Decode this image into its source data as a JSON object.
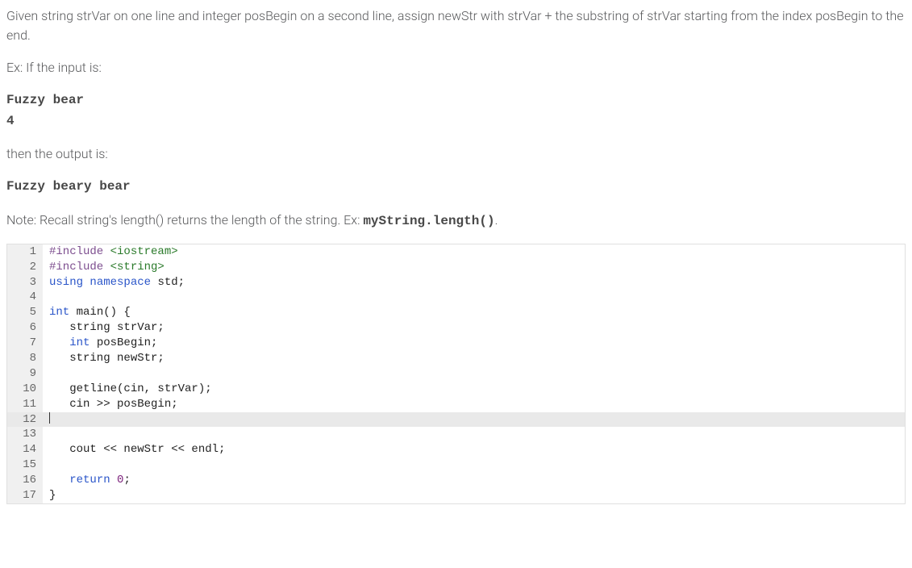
{
  "problem": {
    "p1": "Given string strVar on one line and integer posBegin on a second line, assign newStr with strVar + the substring of strVar starting from the index posBegin to the end.",
    "ex_label": "Ex: If the input is:",
    "input_line1": "Fuzzy bear",
    "input_line2": "4",
    "then_label": "then the output is:",
    "output_line": "Fuzzy beary bear",
    "note_prefix": "Note: Recall string's length() returns the length of the string. Ex: ",
    "note_code": "myString.length()",
    "note_suffix": "."
  },
  "code": {
    "lines": [
      {
        "n": "1",
        "editable": false,
        "tokens": [
          {
            "t": "#include ",
            "c": "pre"
          },
          {
            "t": "<iostream>",
            "c": "str"
          }
        ]
      },
      {
        "n": "2",
        "editable": false,
        "tokens": [
          {
            "t": "#include ",
            "c": "pre"
          },
          {
            "t": "<string>",
            "c": "str"
          }
        ]
      },
      {
        "n": "3",
        "editable": false,
        "tokens": [
          {
            "t": "using ",
            "c": "kw"
          },
          {
            "t": "namespace ",
            "c": "kw"
          },
          {
            "t": "std;",
            "c": ""
          }
        ]
      },
      {
        "n": "4",
        "editable": false,
        "tokens": [
          {
            "t": "",
            "c": ""
          }
        ]
      },
      {
        "n": "5",
        "editable": false,
        "tokens": [
          {
            "t": "int ",
            "c": "kw"
          },
          {
            "t": "main() {",
            "c": ""
          }
        ]
      },
      {
        "n": "6",
        "editable": false,
        "tokens": [
          {
            "t": "   string strVar;",
            "c": ""
          }
        ]
      },
      {
        "n": "7",
        "editable": false,
        "tokens": [
          {
            "t": "   ",
            "c": ""
          },
          {
            "t": "int ",
            "c": "kw"
          },
          {
            "t": "posBegin;",
            "c": ""
          }
        ]
      },
      {
        "n": "8",
        "editable": false,
        "tokens": [
          {
            "t": "   string newStr;",
            "c": ""
          }
        ]
      },
      {
        "n": "9",
        "editable": false,
        "tokens": [
          {
            "t": "",
            "c": ""
          }
        ]
      },
      {
        "n": "10",
        "editable": false,
        "tokens": [
          {
            "t": "   getline(cin, strVar);",
            "c": ""
          }
        ]
      },
      {
        "n": "11",
        "editable": false,
        "tokens": [
          {
            "t": "   cin >> posBegin;",
            "c": ""
          }
        ]
      },
      {
        "n": "12",
        "editable": true,
        "cursor": true,
        "tokens": [
          {
            "t": "",
            "c": ""
          }
        ]
      },
      {
        "n": "13",
        "editable": false,
        "tokens": [
          {
            "t": "",
            "c": ""
          }
        ]
      },
      {
        "n": "14",
        "editable": false,
        "tokens": [
          {
            "t": "   cout << newStr << endl;",
            "c": ""
          }
        ]
      },
      {
        "n": "15",
        "editable": false,
        "tokens": [
          {
            "t": "",
            "c": ""
          }
        ]
      },
      {
        "n": "16",
        "editable": false,
        "tokens": [
          {
            "t": "   ",
            "c": ""
          },
          {
            "t": "return ",
            "c": "kw"
          },
          {
            "t": "0",
            "c": "num"
          },
          {
            "t": ";",
            "c": ""
          }
        ]
      },
      {
        "n": "17",
        "editable": false,
        "tokens": [
          {
            "t": "}",
            "c": ""
          }
        ]
      }
    ]
  }
}
